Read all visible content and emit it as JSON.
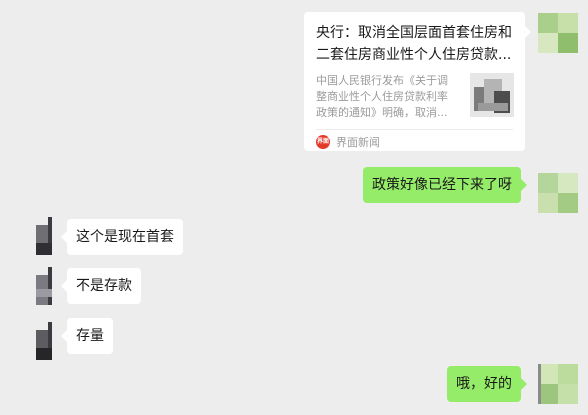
{
  "share_card": {
    "title_line1": "央行：取消全国层面首套住房和",
    "title_line2": "二套住房商业性个人住房贷款...",
    "desc_line1": "中国人民银行发布《关于调",
    "desc_line2": "整商业性个人住房贷款利率",
    "desc_line3": "政策的通知》明确，取消...",
    "source_logo_text": "界面",
    "source_name": "界面新闻",
    "thumbnail_icon": "news-thumbnail-image"
  },
  "messages": [
    {
      "side": "right",
      "text": "政策好像已经下来了呀"
    },
    {
      "side": "left",
      "text": "这个是现在首套"
    },
    {
      "side": "left",
      "text": "不是存款"
    },
    {
      "side": "left",
      "text": "存量"
    },
    {
      "side": "right",
      "text": "哦，好的"
    }
  ],
  "colors": {
    "background": "#ededed",
    "outgoing_bubble": "#95ec69",
    "incoming_bubble": "#ffffff",
    "source_logo": "#e33a2c"
  }
}
